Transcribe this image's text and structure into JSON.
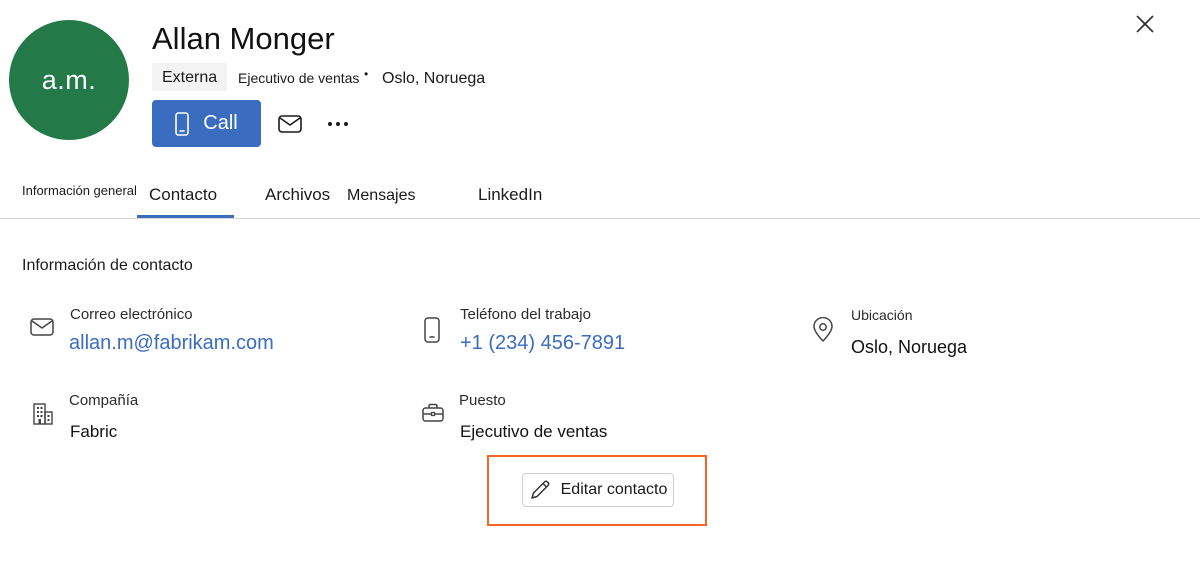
{
  "contact": {
    "initials": "a.m.",
    "name": "Allan Monger",
    "badge": "Externa",
    "role": "Ejecutivo de ventas",
    "separator": "•",
    "location": "Oslo, Noruega"
  },
  "actions": {
    "call_label": "Call"
  },
  "tabs": [
    {
      "label": "Información general"
    },
    {
      "label": "Contacto"
    },
    {
      "label": "Archivos"
    },
    {
      "label": "Mensajes"
    },
    {
      "label": "LinkedIn"
    }
  ],
  "section": {
    "title": "Información de contacto"
  },
  "fields": {
    "email": {
      "label": "Correo electrónico",
      "value": "allan.m@fabrikam.com"
    },
    "phone": {
      "label": "Teléfono del trabajo",
      "value": "+1 (234) 456-7891"
    },
    "location": {
      "label": "Ubicación",
      "value": "Oslo, Noruega"
    },
    "company": {
      "label": "Compañía",
      "value": "Fabric"
    },
    "job": {
      "label": "Puesto",
      "value": "Ejecutivo de ventas"
    }
  },
  "edit": {
    "label": "Editar contacto"
  },
  "colors": {
    "avatar": "#237a48",
    "accent": "#3a6cc0",
    "highlight": "#f26522"
  }
}
